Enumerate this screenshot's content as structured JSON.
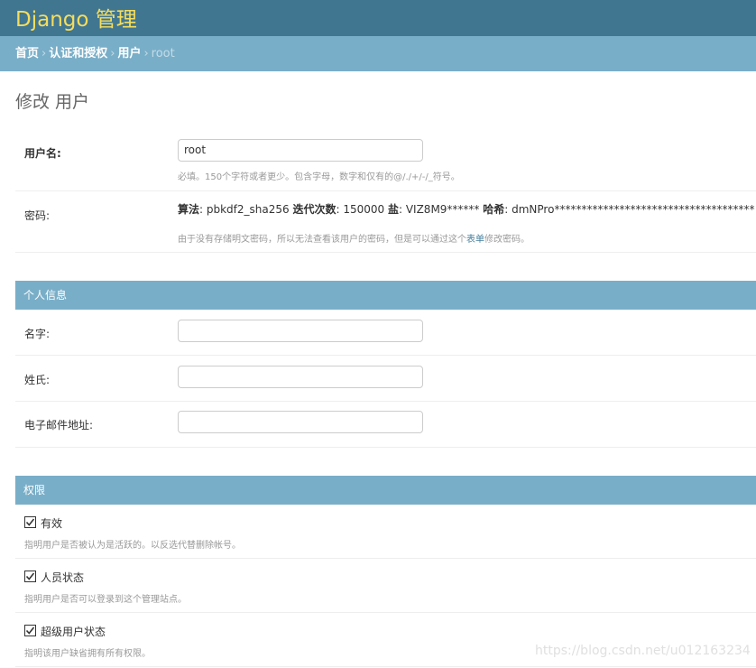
{
  "header": {
    "brand": "Django 管理"
  },
  "breadcrumbs": {
    "home": "首页",
    "app": "认证和授权",
    "model": "用户",
    "current": "root",
    "separator": "›"
  },
  "page_title": "修改 用户",
  "fields": {
    "username": {
      "label": "用户名:",
      "value": "root",
      "help": "必填。150个字符或者更少。包含字母，数字和仅有的@/./+/-/_符号。"
    },
    "password": {
      "label": "密码:",
      "algorithm_label": "算法",
      "algorithm_value": ": pbkdf2_sha256 ",
      "iterations_label": "迭代次数",
      "iterations_value": ": 150000 ",
      "salt_label": "盐",
      "salt_value": ": VIZ8M9****** ",
      "hash_label": "哈希",
      "hash_value": ": dmNPro*************************************",
      "help_before": "由于没有存储明文密码，所以无法查看该用户的密码，但是可以通过这个",
      "help_link": "表单",
      "help_after": "修改密码。"
    }
  },
  "personal_info": {
    "title": "个人信息",
    "first_name_label": "名字:",
    "first_name_value": "",
    "last_name_label": "姓氏:",
    "last_name_value": "",
    "email_label": "电子邮件地址:",
    "email_value": ""
  },
  "permissions": {
    "title": "权限",
    "is_active": {
      "label": "有效",
      "checked": true,
      "help": "指明用户是否被认为是活跃的。以反选代替删除帐号。"
    },
    "is_staff": {
      "label": "人员状态",
      "checked": true,
      "help": "指明用户是否可以登录到这个管理站点。"
    },
    "is_superuser": {
      "label": "超级用户状态",
      "checked": true,
      "help": "指明该用户缺省拥有所有权限。"
    }
  },
  "watermark": "https://blog.csdn.net/u012163234",
  "colors": {
    "header_bg": "#417690",
    "brand": "#f5dd5d",
    "module_bg": "#79aec8",
    "link": "#447e9b"
  }
}
